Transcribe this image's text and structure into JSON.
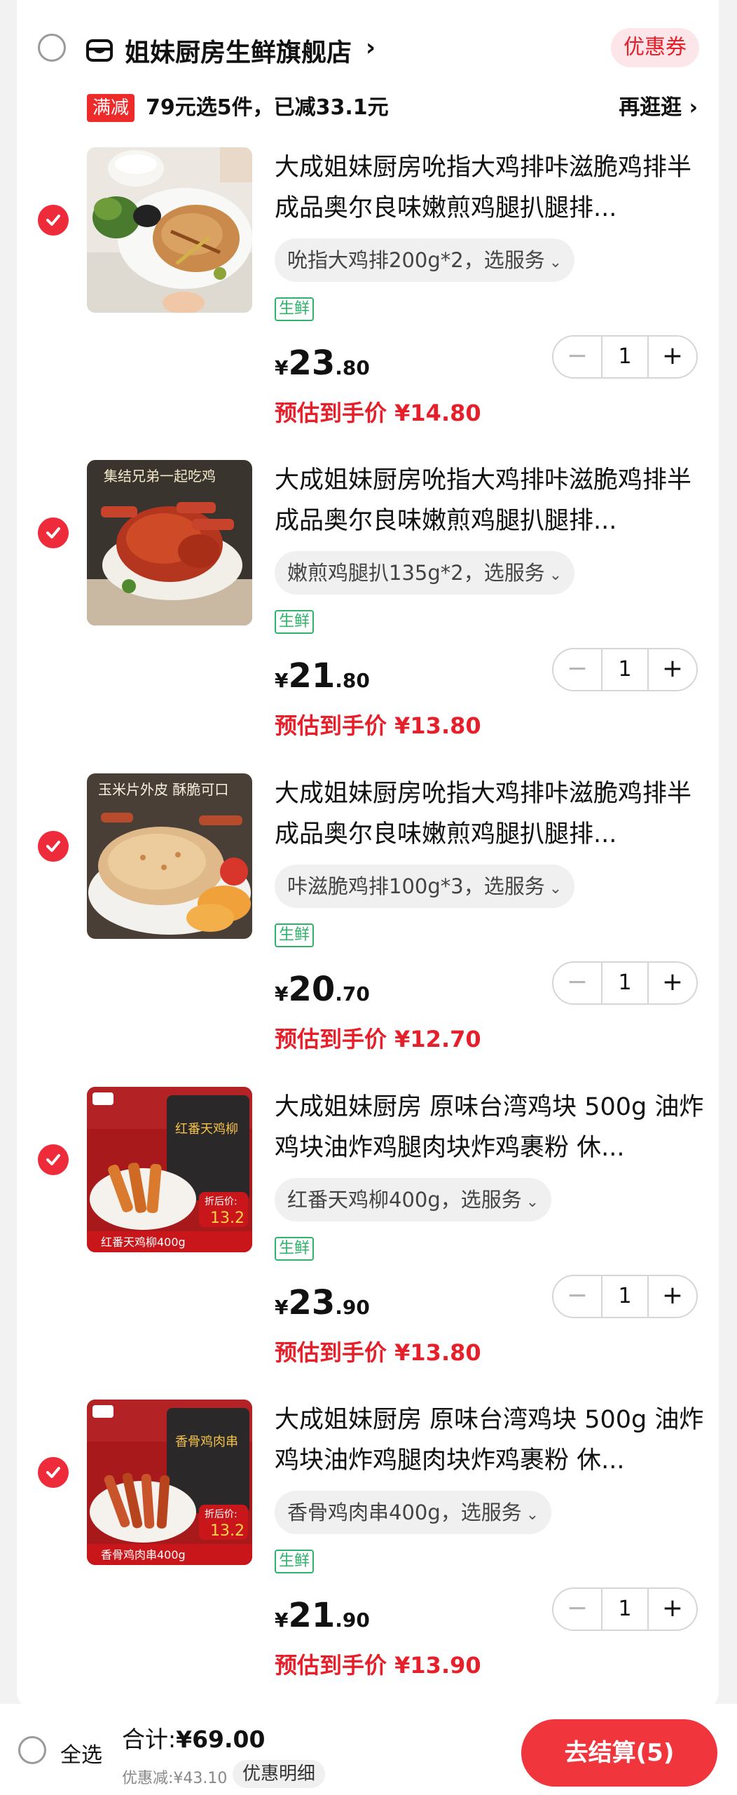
{
  "store": {
    "name": "姐妹厨房生鲜旗舰店",
    "chevron": "›",
    "coupon_label": "优惠券"
  },
  "promo": {
    "tag": "满减",
    "text": "79元选5件，已减33.1元",
    "more_label": "再逛逛 ›"
  },
  "items": [
    {
      "title": "大成姐妹厨房吮指大鸡排咔滋脆鸡排半成品奥尔良味嫩煎鸡腿扒腿排...",
      "spec": "吮指大鸡排200g*2，选服务",
      "tag": "生鲜",
      "currency": "¥",
      "price_int": "23",
      "price_dec": ".80",
      "estimate": "预估到手价 ¥14.80",
      "qty": "1",
      "selected": true
    },
    {
      "title": "大成姐妹厨房吮指大鸡排咔滋脆鸡排半成品奥尔良味嫩煎鸡腿扒腿排...",
      "spec": "嫩煎鸡腿扒135g*2，选服务",
      "tag": "生鲜",
      "currency": "¥",
      "price_int": "21",
      "price_dec": ".80",
      "estimate": "预估到手价 ¥13.80",
      "qty": "1",
      "selected": true
    },
    {
      "title": "大成姐妹厨房吮指大鸡排咔滋脆鸡排半成品奥尔良味嫩煎鸡腿扒腿排...",
      "spec": "咔滋脆鸡排100g*3，选服务",
      "tag": "生鲜",
      "currency": "¥",
      "price_int": "20",
      "price_dec": ".70",
      "estimate": "预估到手价 ¥12.70",
      "qty": "1",
      "selected": true
    },
    {
      "title": "大成姐妹厨房 原味台湾鸡块 500g 油炸鸡块油炸鸡腿肉块炸鸡裹粉 休...",
      "spec": "红番天鸡柳400g，选服务",
      "tag": "生鲜",
      "currency": "¥",
      "price_int": "23",
      "price_dec": ".90",
      "estimate": "预估到手价 ¥13.80",
      "qty": "1",
      "selected": true
    },
    {
      "title": "大成姐妹厨房 原味台湾鸡块 500g 油炸鸡块油炸鸡腿肉块炸鸡裹粉 休...",
      "spec": "香骨鸡肉串400g，选服务",
      "tag": "生鲜",
      "currency": "¥",
      "price_int": "21",
      "price_dec": ".90",
      "estimate": "预估到手价 ¥13.90",
      "qty": "1",
      "selected": true
    }
  ],
  "thumb_text": {
    "t2_banner": "集结兄弟一起吃鸡",
    "t3_banner": "玉米片外皮 酥脆可口",
    "t4_label": "红番天鸡柳400g",
    "t4_pack": "红番天鸡柳",
    "t5_label": "香骨鸡肉串400g",
    "t5_pack": "香骨鸡肉串",
    "sale_prefix": "折后价:",
    "sale_price": "13.2"
  },
  "stepper": {
    "minus": "−",
    "plus": "+"
  },
  "bottom": {
    "select_all": "全选",
    "total_label": "合计:",
    "total_amount": "¥69.00",
    "discount": "优惠减:¥43.10",
    "detail_label": "优惠明细",
    "checkout_label": "去结算(5)"
  },
  "colors": {
    "accent_red": "#ee2b3a",
    "price_red": "#e5202a",
    "fresh_green": "#2fb36b",
    "checkout_red": "#f1353d"
  }
}
